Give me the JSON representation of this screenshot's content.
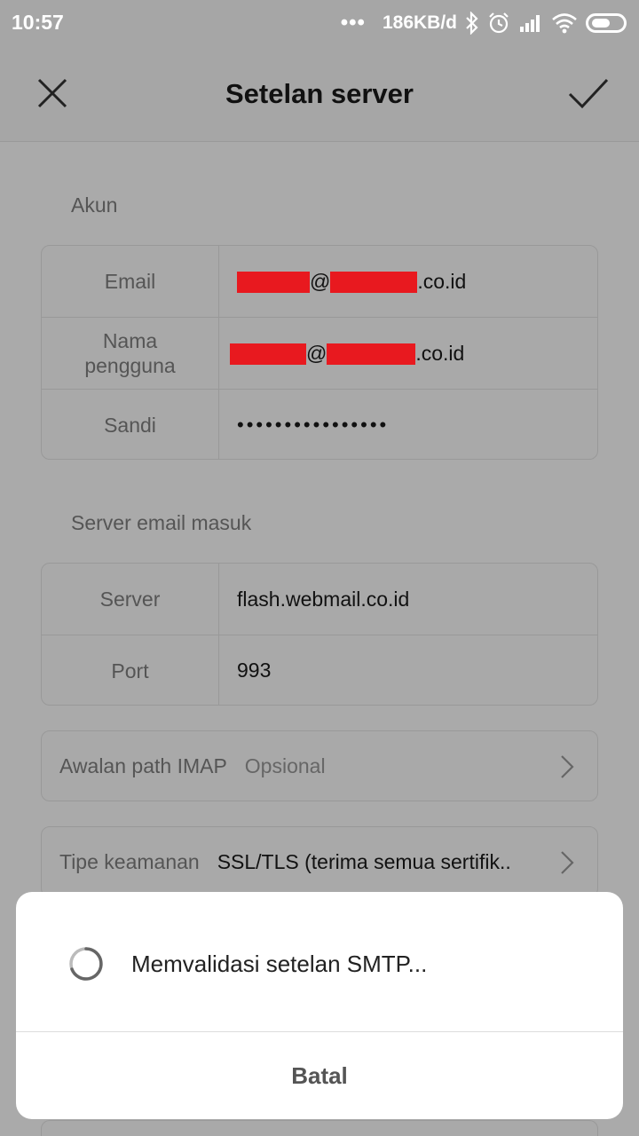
{
  "status_bar": {
    "time": "10:57",
    "dots": "•••",
    "net_speed": "186KB/d"
  },
  "header": {
    "title": "Setelan server",
    "close_icon": "close-icon",
    "confirm_icon": "check-icon"
  },
  "account": {
    "section_label": "Akun",
    "email_label": "Email",
    "email_at": "@",
    "email_suffix": ".co.id",
    "username_label_1": "Nama",
    "username_label_2": "pengguna",
    "username_at": "@",
    "username_suffix": ".co.id",
    "password_label": "Sandi",
    "password_value": "••••••••••••••••"
  },
  "incoming": {
    "section_label": "Server email masuk",
    "server_label": "Server",
    "server_value": "flash.webmail.co.id",
    "port_label": "Port",
    "port_value": "993"
  },
  "imap_prefix": {
    "label": "Awalan path IMAP",
    "placeholder": "Opsional"
  },
  "security": {
    "label": "Tipe keamanan",
    "value": "SSL/TLS (terima semua sertifik.."
  },
  "dialog": {
    "message": "Memvalidasi setelan SMTP...",
    "cancel_label": "Batal"
  },
  "colors": {
    "redaction": "#e8191f",
    "overlay": "#aaaaaa"
  }
}
